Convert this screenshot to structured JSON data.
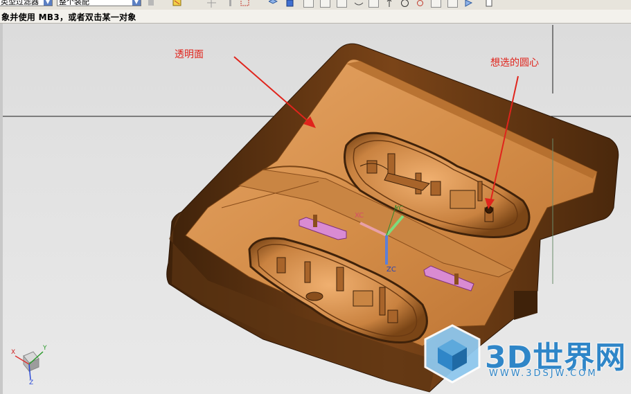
{
  "toolbar": {
    "filter_select": {
      "value": "类型过滤器",
      "shown": "类型过滤器"
    },
    "scope_select": {
      "value": "整个装配"
    },
    "icons": [
      "select-filter-icon",
      "snap-icon",
      "point-icon",
      "inferred-point-icon",
      "view-orient-icon",
      "shade-icon",
      "snap-point-icon",
      "line-icon",
      "arc-icon",
      "curve-icon",
      "point-snap-icon",
      "circle-icon",
      "cube-icon",
      "arrow-up-icon",
      "arrow-diag-icon",
      "view-icon"
    ]
  },
  "status": {
    "prompt": "象并使用 MB3，或者双击某一对象"
  },
  "annotations": {
    "transparent_face": "透明面",
    "target_center": "想选的圆心"
  },
  "csys": {
    "xc": "XC",
    "yc": "YC",
    "zc": "ZC"
  },
  "triad": {
    "x": "X",
    "y": "Y",
    "z": "Z"
  },
  "watermark": {
    "brand": "3D世界网",
    "url": "WWW.3DSJW.COM"
  },
  "colors": {
    "mold_dark": "#5c3412",
    "mold_mid": "#a8642a",
    "mold_light": "#d99a55",
    "annotation_red": "#e0241c",
    "watermark_blue": "#2f86c8"
  }
}
